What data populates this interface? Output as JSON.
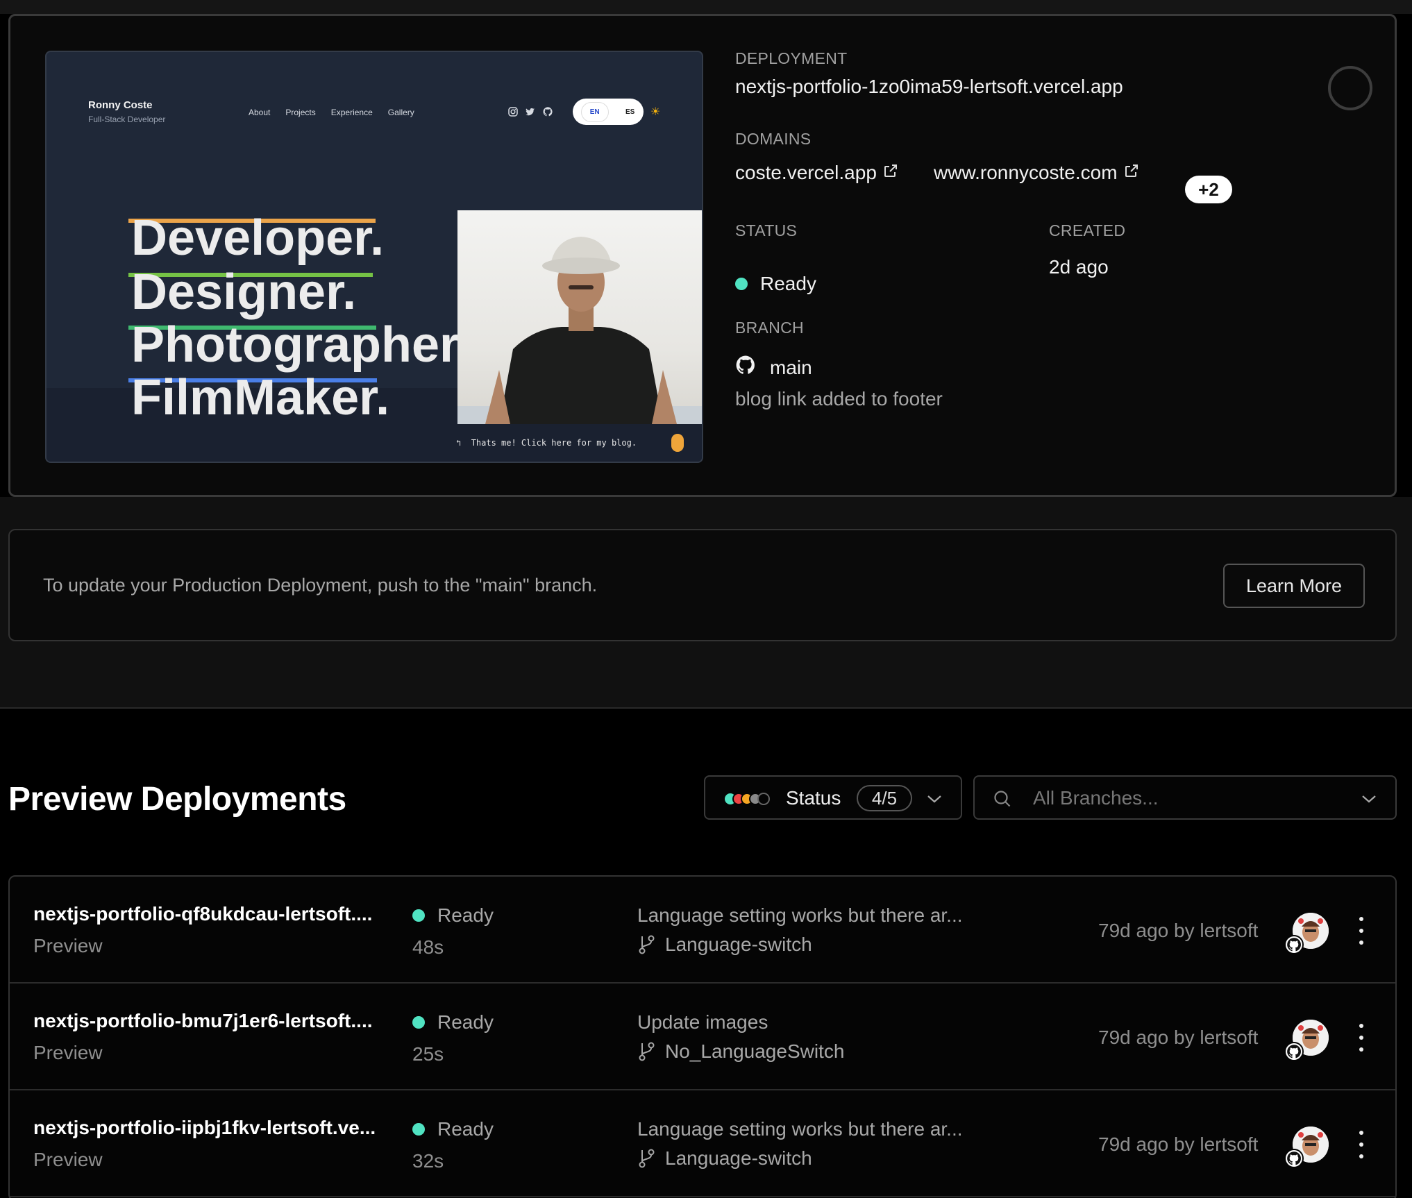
{
  "preview_site": {
    "name": "Ronny Coste",
    "subtitle": "Full-Stack Developer",
    "nav": [
      "About",
      "Projects",
      "Experience",
      "Gallery"
    ],
    "lang_en": "EN",
    "lang_es": "ES",
    "hero": [
      "Developer.",
      "Designer.",
      "Photographer.",
      "FilmMaker."
    ],
    "hero_colors": [
      "#eba44a",
      "#75c245",
      "#3fb96f",
      "#4a7fe7"
    ],
    "caption": "Thats me! Click here for my blog."
  },
  "deployment": {
    "label": "DEPLOYMENT",
    "url": "nextjs-portfolio-1zo0ima59-lertsoft.vercel.app",
    "domains_label": "DOMAINS",
    "domains": [
      "coste.vercel.app",
      "www.ronnycoste.com"
    ],
    "domains_more": "+2",
    "status_label": "STATUS",
    "status": "Ready",
    "created_label": "CREATED",
    "created": "2d ago",
    "branch_label": "BRANCH",
    "branch": "main",
    "commit": "blog link added to footer",
    "status_color": "#50e3c2"
  },
  "notice": {
    "text": "To update your Production Deployment, push to the \"main\" branch.",
    "button": "Learn More"
  },
  "previews": {
    "title": "Preview Deployments",
    "status_filter_label": "Status",
    "status_filter_count": "4/5",
    "branch_placeholder": "All Branches...",
    "rows": [
      {
        "name": "nextjs-portfolio-qf8ukdcau-lertsoft....",
        "env": "Preview",
        "status": "Ready",
        "duration": "48s",
        "message": "Language setting works but there ar...",
        "branch": "Language-switch",
        "age": "79d ago by lertsoft"
      },
      {
        "name": "nextjs-portfolio-bmu7j1er6-lertsoft....",
        "env": "Preview",
        "status": "Ready",
        "duration": "25s",
        "message": "Update images",
        "branch": "No_LanguageSwitch",
        "age": "79d ago by lertsoft"
      },
      {
        "name": "nextjs-portfolio-iipbj1fkv-lertsoft.ve...",
        "env": "Preview",
        "status": "Ready",
        "duration": "32s",
        "message": "Language setting works but there ar...",
        "branch": "Language-switch",
        "age": "79d ago by lertsoft"
      }
    ]
  }
}
